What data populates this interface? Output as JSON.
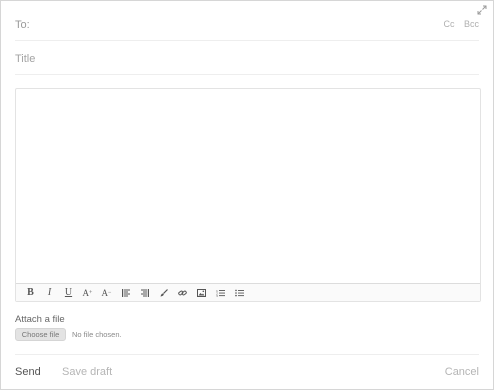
{
  "compose": {
    "to_label": "To:",
    "to_value": "",
    "cc_label": "Cc",
    "bcc_label": "Bcc",
    "title_placeholder": "Title",
    "title_value": "",
    "body_value": ""
  },
  "toolbar": {
    "buttons": [
      {
        "name": "bold-button",
        "label": "B"
      },
      {
        "name": "italic-button",
        "label": "I"
      },
      {
        "name": "underline-button",
        "label": "U"
      },
      {
        "name": "increase-font-button",
        "label": "A",
        "mark": "+"
      },
      {
        "name": "decrease-font-button",
        "label": "A",
        "mark": "−"
      },
      {
        "name": "align-left-button",
        "icon": "align-left-icon"
      },
      {
        "name": "align-right-button",
        "icon": "align-right-icon"
      },
      {
        "name": "brush-button",
        "icon": "brush-icon"
      },
      {
        "name": "link-button",
        "icon": "link-icon"
      },
      {
        "name": "image-button",
        "icon": "image-icon"
      },
      {
        "name": "ordered-list-button",
        "icon": "ordered-list-icon"
      },
      {
        "name": "bullet-list-button",
        "icon": "bullet-list-icon"
      }
    ]
  },
  "attachment": {
    "label": "Attach a file",
    "choose_label": "Choose file",
    "status": "No file chosen."
  },
  "actions": {
    "send_label": "Send",
    "save_draft_label": "Save draft",
    "cancel_label": "Cancel"
  },
  "colors": {
    "border": "#d6d6d6",
    "muted_text": "#b5b5b5",
    "primary_text": "#555555"
  }
}
